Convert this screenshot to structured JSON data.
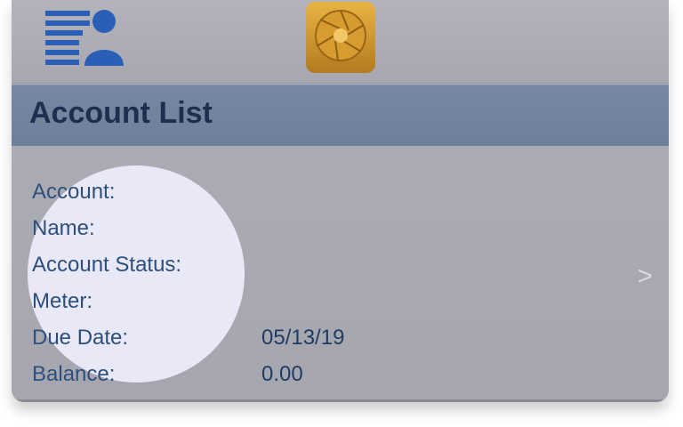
{
  "topbar": {
    "left_icon": "account-list-icon",
    "center_icon": "camera-shutter-icon"
  },
  "header": {
    "title": "Account List"
  },
  "account_card": {
    "fields": [
      {
        "label": "Account:",
        "value": ""
      },
      {
        "label": "Name:",
        "value": ""
      },
      {
        "label": "Account Status:",
        "value": ""
      },
      {
        "label": "Meter:",
        "value": ""
      },
      {
        "label": "Due Date:",
        "value": "05/13/19"
      },
      {
        "label": "Balance:",
        "value": "0.00"
      }
    ],
    "chevron": ">"
  },
  "colors": {
    "accent_blue": "#2b5fb7",
    "title_bar": "#7788a3",
    "title_text": "#1d2e4e",
    "label_text": "#2d4f7c",
    "spotlight": "#e9e8f7"
  }
}
